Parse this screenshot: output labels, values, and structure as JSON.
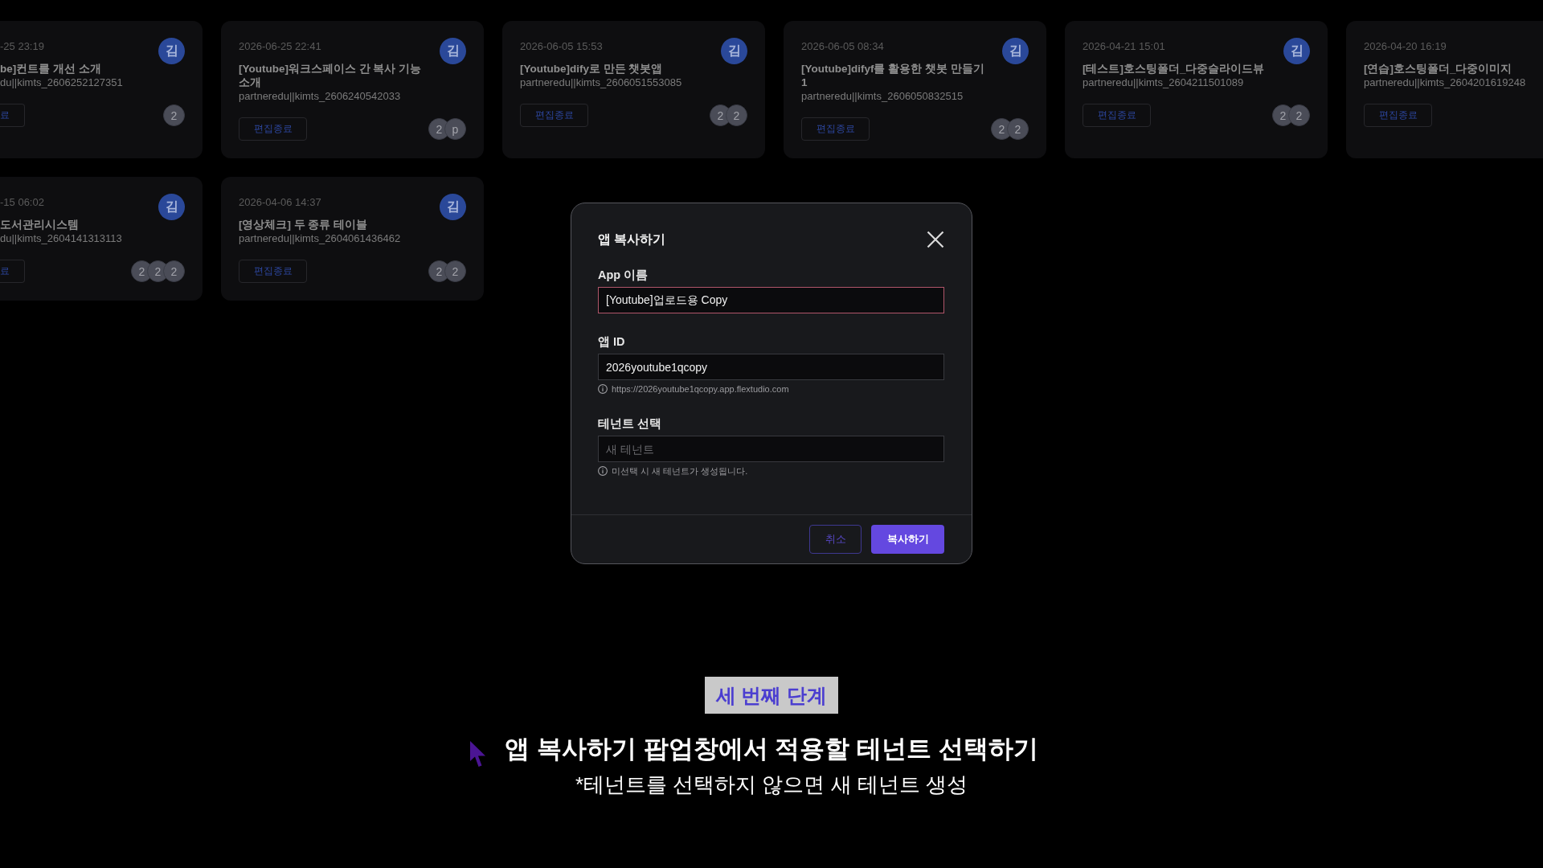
{
  "cards": [
    {
      "kind": "cut",
      "date": "-25 23:19",
      "title": "be]컨트를 개선 소개",
      "app_id": "du||kimts_2606252127351",
      "button": "료",
      "avatar": "김",
      "members": [
        "2"
      ]
    },
    {
      "kind": "full",
      "date": "2026-06-25 22:41",
      "title": "[Youtube]워크스페이스 간 복사 기능 소개",
      "app_id": "partneredu||kimts_2606240542033",
      "button": "편집종료",
      "avatar": "김",
      "members": [
        "2",
        "p"
      ]
    },
    {
      "kind": "full",
      "date": "2026-06-05 15:53",
      "title": "[Youtube]dify로 만든 챗봇앱",
      "app_id": "partneredu||kimts_2606051553085",
      "button": "편집종료",
      "avatar": "김",
      "members": [
        "2",
        "2"
      ]
    },
    {
      "kind": "full",
      "date": "2026-06-05 08:34",
      "title": "[Youtube]difyf를 활용한 챗봇 만들기 1",
      "app_id": "partneredu||kimts_2606050832515",
      "button": "편집종료",
      "avatar": "김",
      "members": [
        "2",
        "2"
      ]
    },
    {
      "kind": "full",
      "date": "2026-04-21 15:01",
      "title": "[테스트]호스팅폴더_다중슬라이드뷰",
      "app_id": "partneredu||kimts_2604211501089",
      "button": "편집종료",
      "avatar": "김",
      "members": [
        "2",
        "2"
      ]
    },
    {
      "kind": "full",
      "date": "2026-04-20 16:19",
      "title": "[연습]호스팅폴더_다중이미지",
      "app_id": "partneredu||kimts_2604201619248",
      "button": "편집종료"
    },
    {
      "kind": "cut",
      "date": "-15 06:02",
      "title": "도서관리시스템",
      "app_id": "du||kimts_2604141313113",
      "button": "료",
      "avatar": "김",
      "members": [
        "2",
        "2",
        "2"
      ]
    },
    {
      "kind": "full",
      "date": "2026-04-06 14:37",
      "title": "[영상체크] 두 종류 테이블",
      "app_id": "partneredu||kimts_2604061436462",
      "button": "편집종료",
      "avatar": "김",
      "members": [
        "2",
        "2"
      ]
    }
  ],
  "dialog": {
    "title": "앱 복사하기",
    "fields": [
      {
        "label": "App 이름",
        "value": "[Youtube]업로드용 Copy",
        "focused": true
      },
      {
        "label": "앱 ID",
        "value": "2026youtube1qcopy",
        "focused": false,
        "hint": "https://2026youtube1qcopy.app.flextudio.com"
      },
      {
        "label": "테넌트 선택",
        "placeholder": "새 테넌트",
        "focused": false,
        "hint": "미선택 시 새 테넌트가 생성됩니다."
      }
    ],
    "buttons": [
      {
        "label": "취소",
        "kind": "secondary"
      },
      {
        "label": "복사하기",
        "kind": "primary"
      }
    ]
  },
  "caption": {
    "step": "세 번째 단계",
    "headline": "앱 복사하기 팝업창에서 적용할 테넌트 선택하기",
    "note": "*테넌트를 선택하지 않으면 새 테넌트 생성"
  }
}
